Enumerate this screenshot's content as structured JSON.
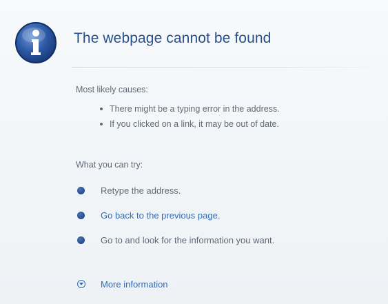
{
  "page": {
    "title": "The webpage cannot be found",
    "icon": "info-icon"
  },
  "causes": {
    "label": "Most likely causes:",
    "items": [
      "There might be a typing error in the address.",
      "If you clicked on a link, it may be out of date."
    ]
  },
  "try": {
    "label": "What you can try:",
    "items": [
      {
        "text": "Retype the address.",
        "link": false
      },
      {
        "text": "Go back to the previous page.",
        "link": true
      },
      {
        "text": "Go to  and look for the information you want.",
        "link": false
      }
    ]
  },
  "more": {
    "label": "More information",
    "icon": "chevron-down-circle-icon"
  },
  "colors": {
    "title": "#27508f",
    "link": "#2f6bb7",
    "text": "#5f6a76",
    "background": "#f3f5f7"
  }
}
